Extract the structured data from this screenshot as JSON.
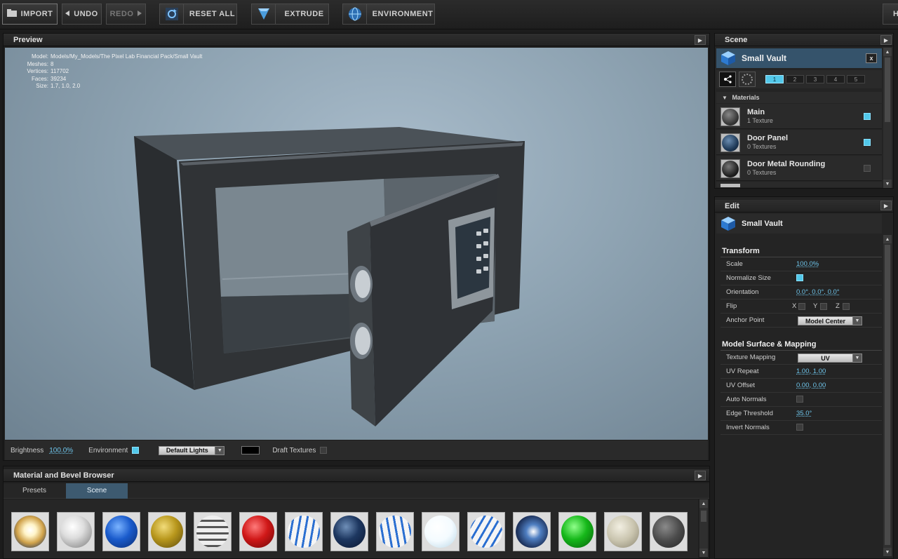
{
  "toolbar": {
    "import": "IMPORT",
    "undo": "UNDO",
    "redo": "REDO",
    "reset_all": "RESET ALL",
    "extrude": "EXTRUDE",
    "environment": "ENVIRONMENT",
    "right_cut": "H"
  },
  "preview": {
    "title": "Preview",
    "info": [
      {
        "k": "Model:",
        "v": "Models/My_Models/The Pixel Lab Financial Pack/Small Vault"
      },
      {
        "k": "Meshes:",
        "v": "8"
      },
      {
        "k": "Vertices:",
        "v": "117702"
      },
      {
        "k": "Faces:",
        "v": "39234"
      },
      {
        "k": "Size:",
        "v": "1.7, 1.0, 2.0"
      }
    ],
    "footer": {
      "brightness_label": "Brightness",
      "brightness_value": "100.0%",
      "environment_label": "Environment",
      "lights_option": "Default Lights",
      "draft_label": "Draft Textures"
    }
  },
  "browser": {
    "title": "Material and Bevel Browser",
    "tabs": [
      "Presets",
      "Scene"
    ],
    "active_tab": "Scene",
    "swatches": [
      "glow",
      "silver",
      "blue",
      "gold",
      "stripe",
      "red",
      "american-white",
      "navy",
      "american-white-2",
      "white",
      "american-white-3",
      "chrome-blue",
      "green",
      "beige",
      "dark-grey"
    ]
  },
  "scene": {
    "title": "Scene",
    "object_name": "Small Vault",
    "close_label": "x",
    "layers": [
      "1",
      "2",
      "3",
      "4",
      "5"
    ],
    "materials_label": "Materials",
    "materials": [
      {
        "name": "Main",
        "sub": "1 Texture",
        "checked": true
      },
      {
        "name": "Door Panel",
        "sub": "0 Textures",
        "checked": true
      },
      {
        "name": "Door Metal Rounding",
        "sub": "0 Textures",
        "checked": false
      }
    ]
  },
  "edit": {
    "title": "Edit",
    "object_name": "Small Vault",
    "transform_title": "Transform",
    "transform": {
      "scale_label": "Scale",
      "scale_value": "100.0%",
      "normalize_label": "Normalize Size",
      "orientation_label": "Orientation",
      "orientation_value": "0.0°, 0.0°, 0.0°",
      "flip_label": "Flip",
      "flip_x": "X",
      "flip_y": "Y",
      "flip_z": "Z",
      "anchor_label": "Anchor Point",
      "anchor_value": "Model Center"
    },
    "surface_title": "Model Surface & Mapping",
    "surface": {
      "mapping_label": "Texture Mapping",
      "mapping_value": "UV",
      "repeat_label": "UV Repeat",
      "repeat_value": "1.00, 1.00",
      "offset_label": "UV Offset",
      "offset_value": "0.00, 0.00",
      "auto_normals_label": "Auto Normals",
      "edge_label": "Edge Threshold",
      "edge_value": "35.0°",
      "invert_label": "Invert Normals"
    }
  },
  "colors": {
    "accent": "#52c8ea",
    "active_tab": "#3d5a70",
    "viewport_bg": "#8ea3b2"
  }
}
